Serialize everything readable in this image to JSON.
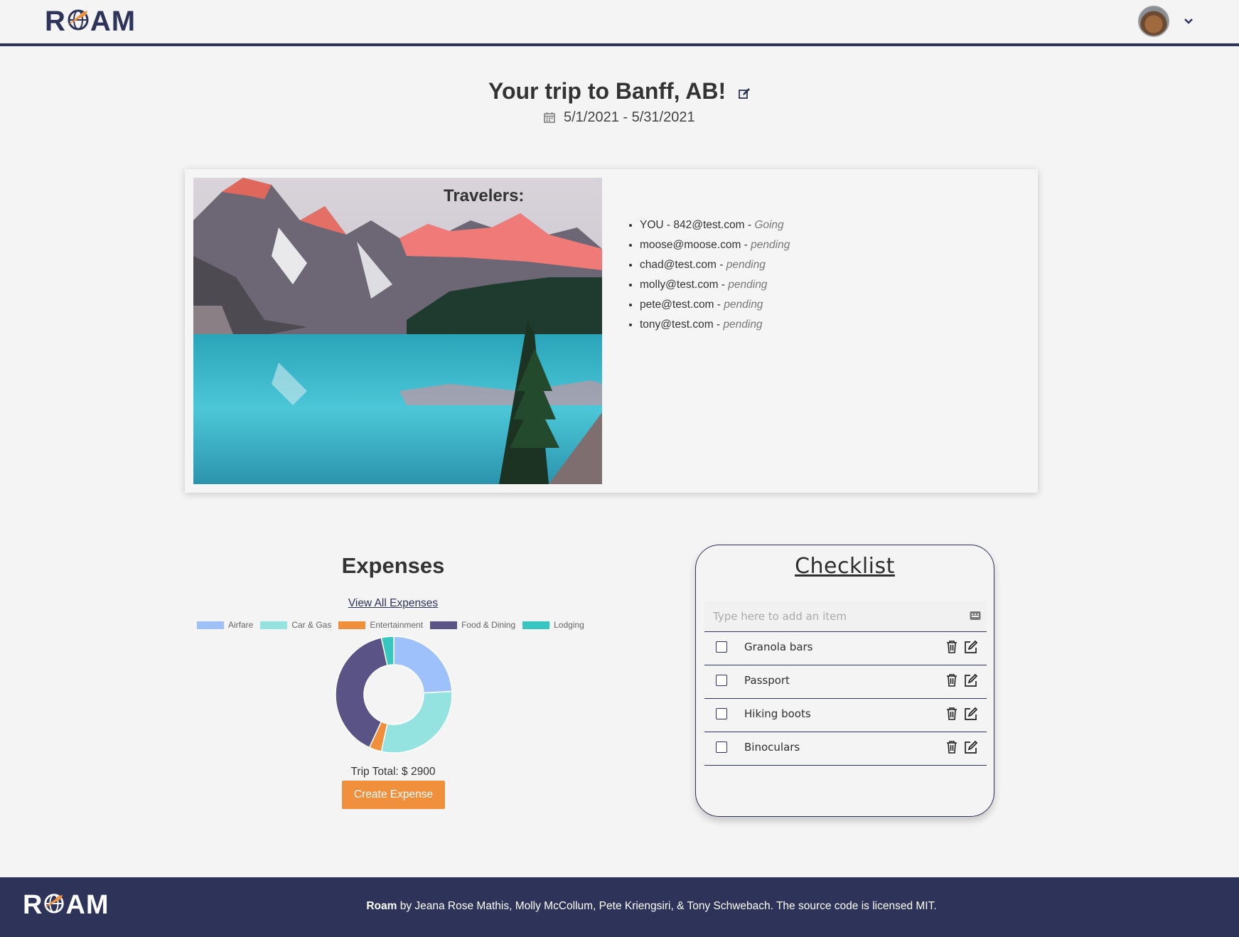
{
  "brand": {
    "logo_text_left": "R",
    "logo_text_right": "AM",
    "footer_brand": "Roam"
  },
  "colors": {
    "navy": "#2e3359",
    "orange": "#f08f3c"
  },
  "header": {
    "title": "Your trip to Banff, AB!",
    "dates": "5/1/2021 - 5/31/2021"
  },
  "travelers": {
    "heading": "Travelers:",
    "list": [
      {
        "name": "YOU - 842@test.com",
        "sep": " - ",
        "status": "Going"
      },
      {
        "name": "moose@moose.com",
        "sep": " - ",
        "status": "pending"
      },
      {
        "name": "chad@test.com",
        "sep": " - ",
        "status": "pending"
      },
      {
        "name": "molly@test.com",
        "sep": " - ",
        "status": "pending"
      },
      {
        "name": "pete@test.com",
        "sep": " - ",
        "status": "pending"
      },
      {
        "name": "tony@test.com",
        "sep": " - ",
        "status": "pending"
      }
    ]
  },
  "expenses": {
    "title": "Expenses",
    "view_all": "View All Expenses",
    "total": "Trip Total: $ 2900",
    "create_button": "Create Expense"
  },
  "chart_data": {
    "type": "pie",
    "categories": [
      "Airfare",
      "Car & Gas",
      "Entertainment",
      "Food & Dining",
      "Lodging"
    ],
    "values": [
      700,
      850,
      100,
      1150,
      100
    ],
    "colors": [
      "#9ec0fb",
      "#94e3e0",
      "#f08f3c",
      "#5a5486",
      "#38c6c0"
    ],
    "legend": "top",
    "title": "",
    "xlabel": "",
    "ylabel": ""
  },
  "checklist": {
    "title": "Checklist",
    "placeholder": "Type here to add an item",
    "items": [
      {
        "label": "Granola bars"
      },
      {
        "label": "Passport"
      },
      {
        "label": "Hiking boots"
      },
      {
        "label": "Binoculars"
      }
    ]
  },
  "footer": {
    "text": "by Jeana Rose Mathis, Molly McCollum, Pete Kriengsiri, & Tony Schwebach. The source code is licensed MIT."
  }
}
